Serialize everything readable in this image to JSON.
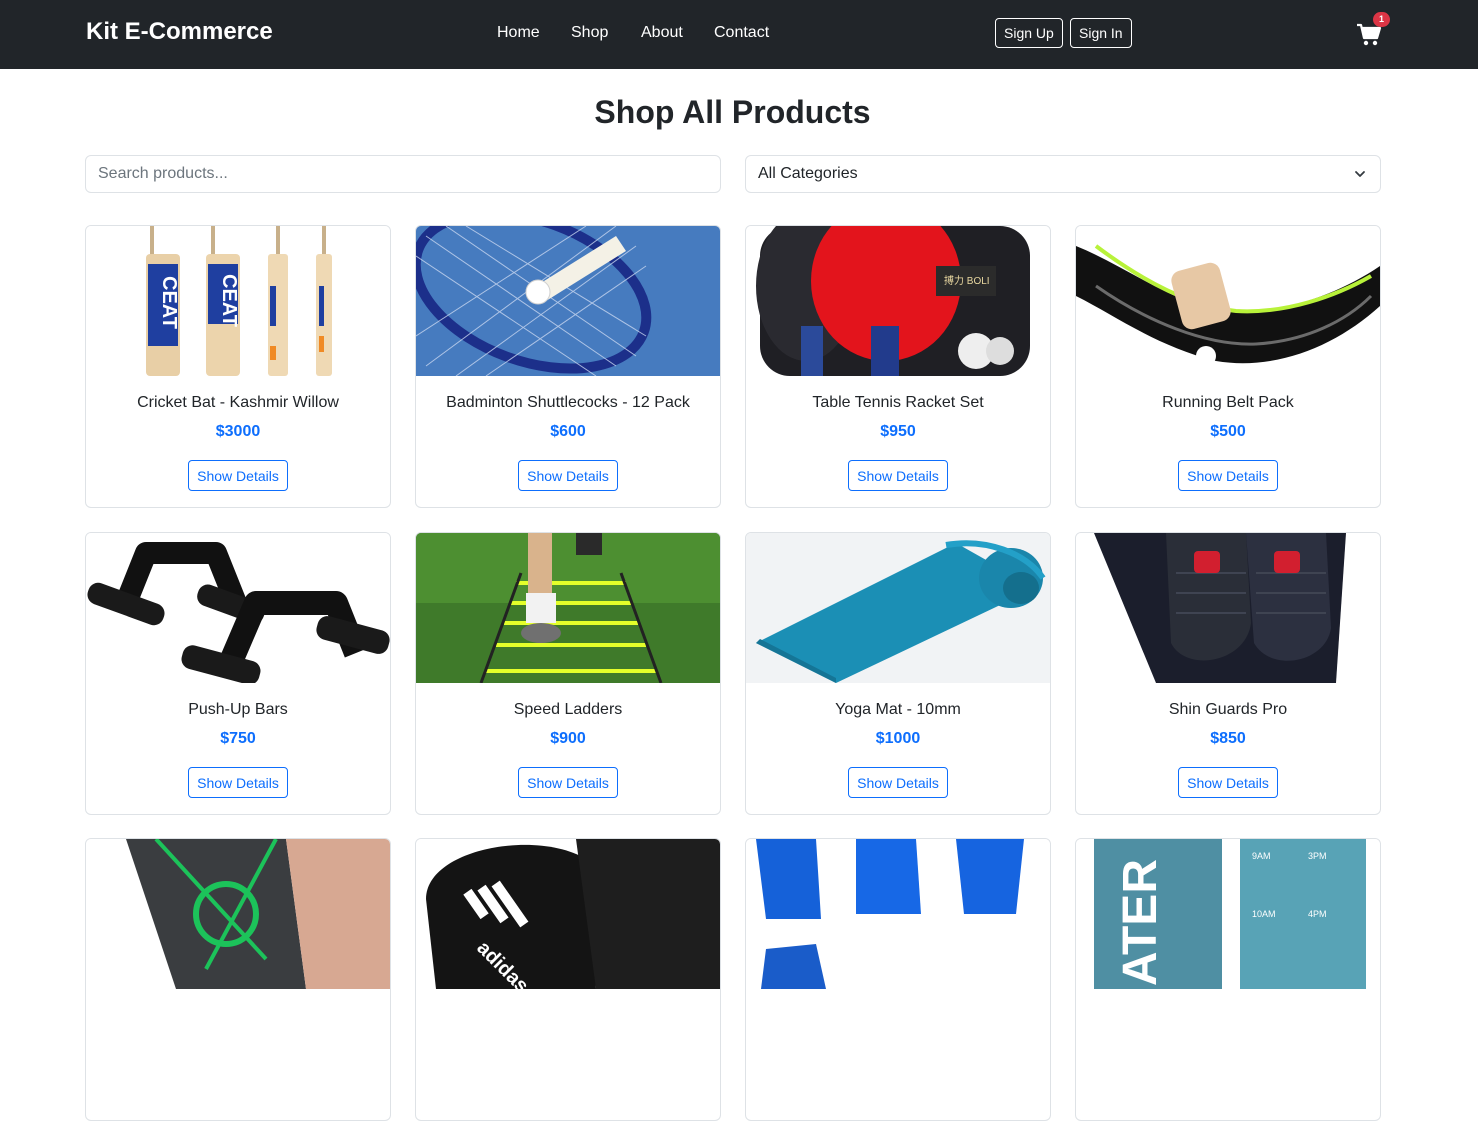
{
  "navbar": {
    "brand": "Kit E-Commerce",
    "links": [
      "Home",
      "Shop",
      "About",
      "Contact"
    ],
    "sign_up": "Sign Up",
    "sign_in": "Sign In",
    "cart_icon": "shopping-cart-icon",
    "cart_count": "1"
  },
  "page": {
    "title": "Shop All Products"
  },
  "filters": {
    "search_placeholder": "Search products...",
    "category_selected": "All Categories"
  },
  "products": [
    {
      "name": "Cricket Bat - Kashmir Willow",
      "price": "$3000",
      "button": "Show Details"
    },
    {
      "name": "Badminton Shuttlecocks - 12 Pack",
      "price": "$600",
      "button": "Show Details"
    },
    {
      "name": "Table Tennis Racket Set",
      "price": "$950",
      "button": "Show Details"
    },
    {
      "name": "Running Belt Pack",
      "price": "$500",
      "button": "Show Details"
    },
    {
      "name": "Push-Up Bars",
      "price": "$750",
      "button": "Show Details"
    },
    {
      "name": "Speed Ladders",
      "price": "$900",
      "button": "Show Details"
    },
    {
      "name": "Yoga Mat - 10mm",
      "price": "$1000",
      "button": "Show Details"
    },
    {
      "name": "Shin Guards Pro",
      "price": "$850",
      "button": "Show Details"
    },
    {
      "name": "",
      "price": "",
      "button": ""
    },
    {
      "name": "",
      "price": "",
      "button": ""
    },
    {
      "name": "",
      "price": "",
      "button": ""
    },
    {
      "name": "",
      "price": "",
      "button": ""
    }
  ],
  "colors": {
    "navbar_bg": "#212529",
    "accent": "#0d6efd",
    "badge": "#dc3545"
  }
}
